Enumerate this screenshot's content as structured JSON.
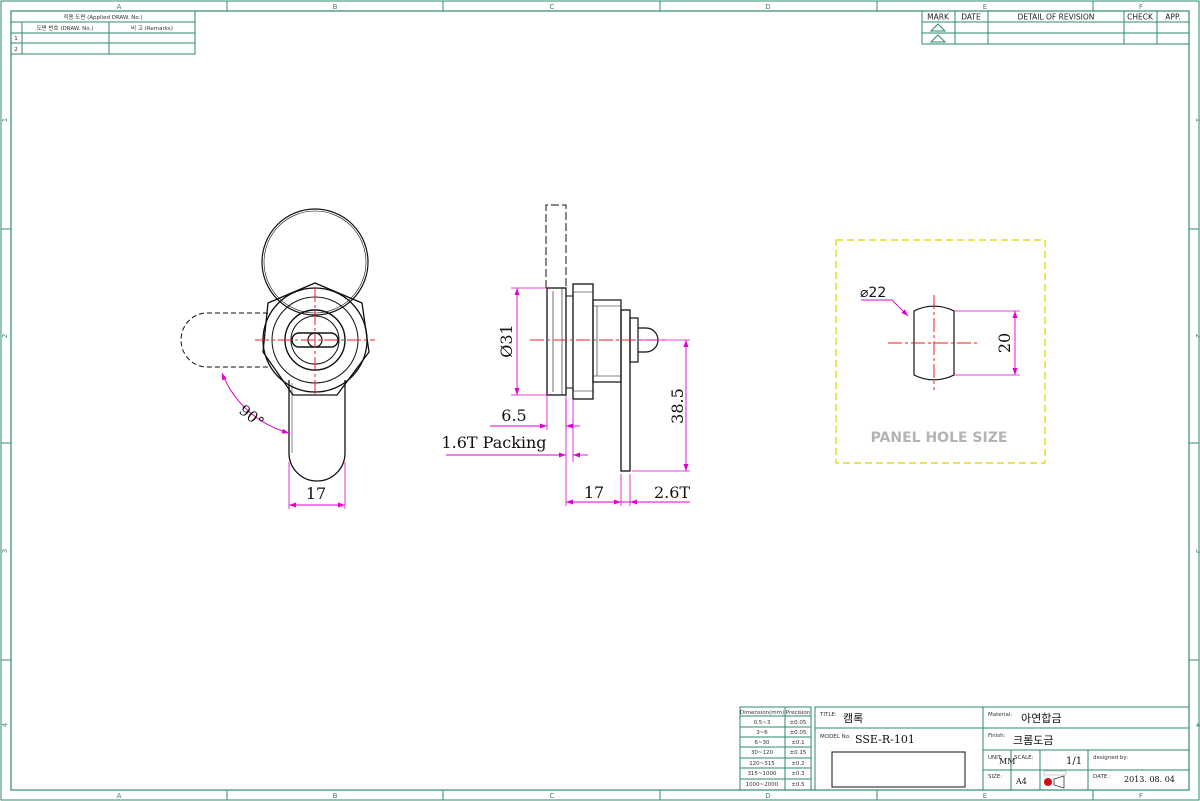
{
  "zones": {
    "columns": [
      "A",
      "B",
      "C",
      "D",
      "E",
      "F"
    ],
    "rows": [
      "1",
      "2",
      "3",
      "4"
    ]
  },
  "applied_table": {
    "header": "적용 도면 (Applied DRAW. No.)",
    "col1": "도면 번호 (DRAW. No.)",
    "col2": "비 고 (Remarks)",
    "row_numbers": [
      "1",
      "2"
    ]
  },
  "revision_table": {
    "headers": [
      "MARK",
      "DATE",
      "DETAIL OF REVISION",
      "CHECK",
      "APP."
    ]
  },
  "dimensions": {
    "angle": "90°",
    "front_width": "17",
    "diameter": "Ø31",
    "flange": "6.5",
    "packing": "1.6T Packing",
    "cam_length": "38.5",
    "body_length": "17",
    "cam_thickness": "2.6T",
    "hole_diameter": "⌀22",
    "hole_flat": "20"
  },
  "panel_label": "PANEL HOLE SIZE",
  "tolerance_table": {
    "headers": [
      "Dimension(mm)",
      "Precision"
    ],
    "rows": [
      [
        "0.5~3",
        "±0.05"
      ],
      [
        "3~6",
        "±0.05"
      ],
      [
        "6~30",
        "±0.1"
      ],
      [
        "30~120",
        "±0.15"
      ],
      [
        "120~315",
        "±0.2"
      ],
      [
        "315~1000",
        "±0.3"
      ],
      [
        "1000~2000",
        "±0.5"
      ]
    ]
  },
  "title_block": {
    "title_label": "TITLE:",
    "title": "캠록",
    "model_label": "MODEL No.",
    "model": "SSE-R-101",
    "material_label": "Material:",
    "material": "아연합금",
    "finish_label": "Finish:",
    "finish": "크롬도금",
    "unit_label": "UNIT:",
    "unit": "MM",
    "scale_label": "SCALE:",
    "scale": "1/1",
    "designed_label": "designed by:",
    "size_label": "SIZE:",
    "size": "A4",
    "date_label": "DATE :",
    "date": "2013. 08. 04"
  },
  "colors": {
    "frame": "#2e8b6e",
    "outline": "#111111",
    "centerline": "#e8202a",
    "dimension": "#e000d0",
    "panel_box": "#e4dc1a"
  }
}
